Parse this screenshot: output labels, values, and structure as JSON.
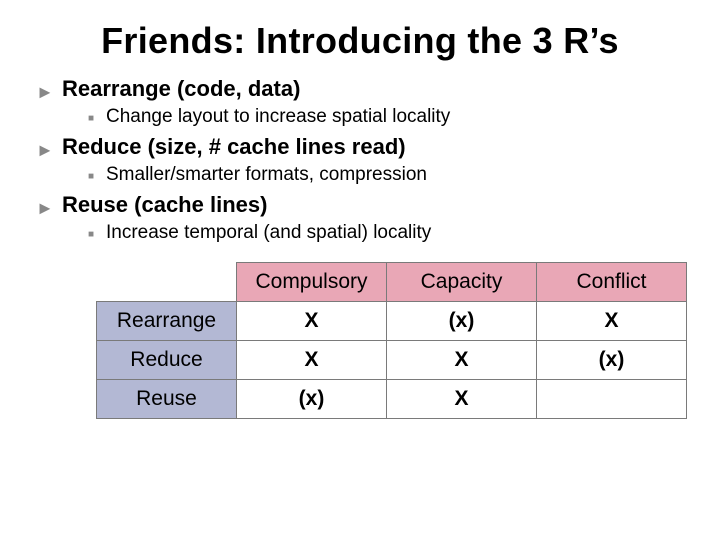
{
  "title": "Friends: Introducing the 3 R’s",
  "bullets": [
    {
      "heading": "Rearrange (code, data)",
      "sub": [
        "Change layout to increase spatial locality"
      ]
    },
    {
      "heading": "Reduce (size, # cache lines read)",
      "sub": [
        "Smaller/smarter formats, compression"
      ]
    },
    {
      "heading": "Reuse (cache lines)",
      "sub": [
        "Increase temporal (and spatial) locality"
      ]
    }
  ],
  "table": {
    "columns": [
      "Compulsory",
      "Capacity",
      "Conflict"
    ],
    "rows": [
      {
        "label": "Rearrange",
        "cells": [
          "X",
          "(x)",
          "X"
        ]
      },
      {
        "label": "Reduce",
        "cells": [
          "X",
          "X",
          "(x)"
        ]
      },
      {
        "label": "Reuse",
        "cells": [
          "(x)",
          "X",
          ""
        ]
      }
    ]
  }
}
